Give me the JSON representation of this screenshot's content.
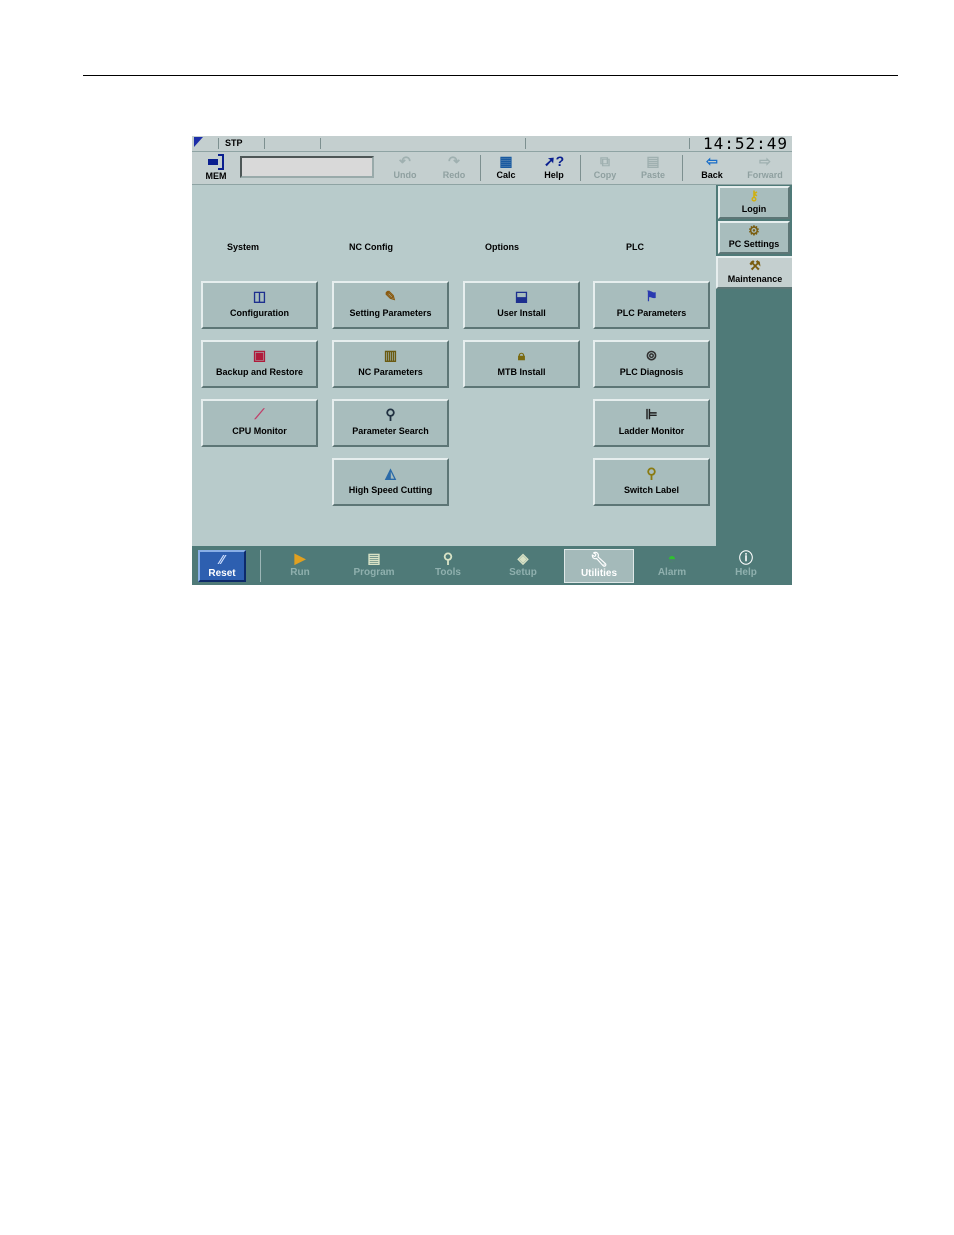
{
  "status": {
    "mode": "STP",
    "clock": "14:52:49"
  },
  "toolbar": {
    "mem_label": "MEM",
    "undo": "Undo",
    "redo": "Redo",
    "calc": "Calc",
    "help": "Help",
    "copy": "Copy",
    "paste": "Paste",
    "back": "Back",
    "forward": "Forward"
  },
  "categories": {
    "system": "System",
    "nc_config": "NC Config",
    "options": "Options",
    "plc": "PLC"
  },
  "buttons": {
    "configuration": "Configuration",
    "backup_restore": "Backup and Restore",
    "cpu_monitor": "CPU Monitor",
    "setting_parameters": "Setting Parameters",
    "nc_parameters": "NC Parameters",
    "parameter_search": "Parameter Search",
    "high_speed_cutting": "High Speed Cutting",
    "user_install": "User Install",
    "mtb_install": "MTB Install",
    "plc_parameters": "PLC Parameters",
    "plc_diagnosis": "PLC Diagnosis",
    "ladder_monitor": "Ladder Monitor",
    "switch_label": "Switch Label"
  },
  "side_tabs": {
    "login": "Login",
    "pc_settings": "PC Settings",
    "maintenance": "Maintenance"
  },
  "nav": {
    "reset": "Reset",
    "run": "Run",
    "program": "Program",
    "tools": "Tools",
    "setup": "Setup",
    "utilities": "Utilities",
    "alarm": "Alarm",
    "help": "Help"
  },
  "icons": {
    "mem": "mem-icon",
    "undo": "undo-icon",
    "redo": "redo-icon",
    "calc": "calculator-icon",
    "help": "help-cursor-icon",
    "copy": "copy-icon",
    "paste": "paste-icon",
    "back": "back-arrow-icon",
    "forward": "forward-arrow-icon"
  },
  "colors": {
    "screen_bg": "#4f7a78",
    "panel_bg": "#b8cbcb",
    "button_bg": "#a8bdbd",
    "reset_blue": "#2d5fb0",
    "active_nav": "#a4baba"
  }
}
